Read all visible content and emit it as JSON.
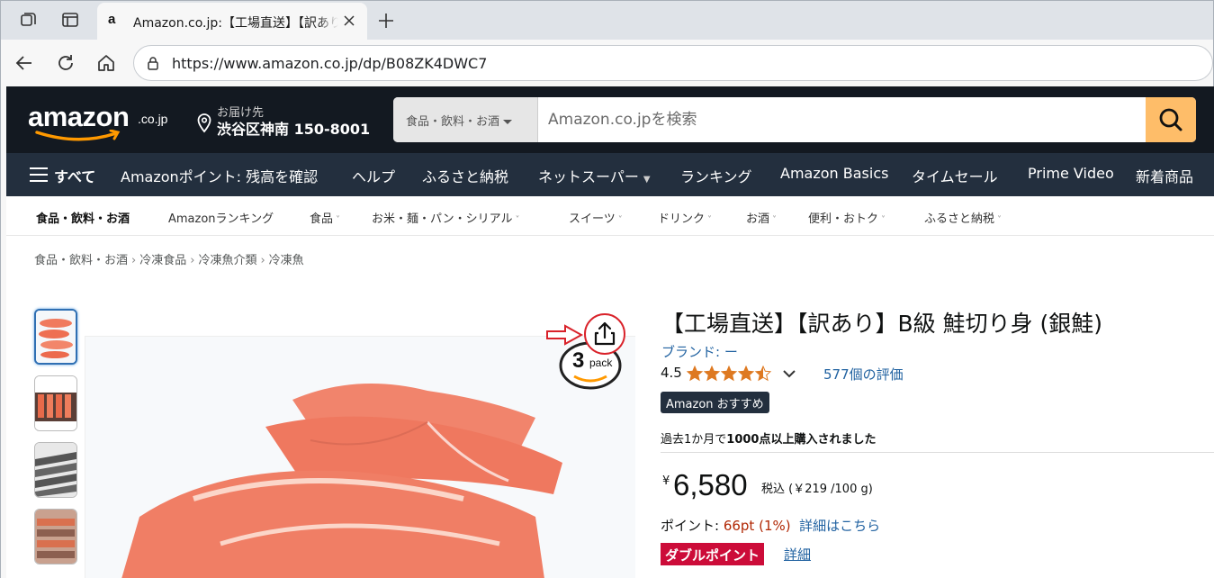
{
  "browser": {
    "tab_title": "Amazon.co.jp:【工場直送】【訳あり】B級 鮭切り身",
    "url": "https://www.amazon.co.jp/dp/B08ZK4DWC7"
  },
  "header": {
    "logo_text": "amazon",
    "logo_tld": ".co.jp",
    "deliver_label": "お届け先",
    "deliver_address": "渋谷区神南 150-8001",
    "search_category": "食品・飲料・お酒",
    "search_placeholder": "Amazon.co.jpを検索"
  },
  "nav": {
    "all": "すべて",
    "items": [
      "Amazonポイント: 残高を確認",
      "ヘルプ",
      "ふるさと納税",
      "ネットスーパー",
      "ランキング",
      "Amazon Basics",
      "タイムセール",
      "Prime Video",
      "新着商品"
    ]
  },
  "subnav": {
    "items": [
      "食品・飲料・お酒",
      "Amazonランキング",
      "食品",
      "お米・麺・パン・シリアル",
      "スイーツ",
      "ドリンク",
      "お酒",
      "便利・おトク",
      "ふるさと納税"
    ]
  },
  "breadcrumb": [
    "食品・飲料・お酒",
    "冷凍食品",
    "冷凍魚介類",
    "冷凍魚"
  ],
  "product": {
    "title": "【工場直送】【訳あり】B級 鮭切り身 (銀鮭)",
    "brand": "ブランド: ー",
    "rating": "4.5",
    "rating_count": "577個の評価",
    "badge": "Amazon おすすめ",
    "bought_prefix": "過去1か月で",
    "bought_bold": "1000点以上購入されました",
    "price_symbol": "¥",
    "price": "6,580",
    "price_tax": "税込 (￥219 /100 g)",
    "points_label": "ポイント: ",
    "points_value": "66pt  (1%)",
    "points_link": "詳細はこちら",
    "double_badge": "ダブルポイント",
    "double_link": "詳細",
    "pack_number": "3",
    "pack_word": "pack"
  },
  "colors": {
    "nav_bg": "#131921",
    "subnav_bg": "#232f3e",
    "search_btn": "#febd69",
    "link": "#2162a1",
    "price_red": "#b12704",
    "badge_red": "#cc0c39",
    "star": "#de7921"
  }
}
